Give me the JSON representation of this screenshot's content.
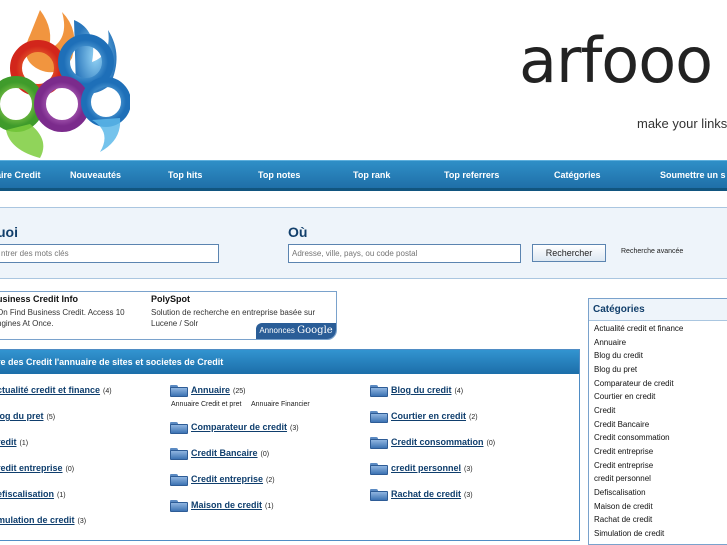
{
  "header": {
    "brand_word": "arfooo",
    "brand_tagline": "make your links"
  },
  "nav": {
    "items": [
      "aire Credit",
      "Nouveautés",
      "Top hits",
      "Top notes",
      "Top rank",
      "Top referrers",
      "Catégories",
      "Soumettre un s"
    ]
  },
  "search": {
    "what_heading": "uoi",
    "what_placeholder": "ntrer des mots clés",
    "where_heading": "Où",
    "where_placeholder": "Adresse, ville, pays, ou code postal",
    "button_label": "Rechercher",
    "advanced_link": "Recherche avancée"
  },
  "ads": {
    "items": [
      {
        "title": "usiness Credit Info",
        "text": "On Find Business Credit. Access 10 ngines At Once."
      },
      {
        "title": "PolySpot",
        "text": "Solution de recherche en entreprise basée sur Lucene / Solr"
      }
    ],
    "annonces_label": "Annonces",
    "google_label": "Google"
  },
  "directory": {
    "heading": "re des Credit l'annuaire de sites et societes de Credit",
    "columns": [
      [
        {
          "label": "ctualité credit et finance",
          "count": "(4)"
        },
        {
          "label": "log du pret",
          "count": "(5)"
        },
        {
          "label": "redit",
          "count": "(1)"
        },
        {
          "label": "redit entreprise",
          "count": "(0)"
        },
        {
          "label": "efiscalisation",
          "count": "(1)"
        },
        {
          "label": "mulation de credit",
          "count": "(3)"
        }
      ],
      [
        {
          "label": "Annuaire",
          "count": "(25)"
        },
        {
          "label": "Comparateur de credit",
          "count": "(3)"
        },
        {
          "label": "Credit Bancaire",
          "count": "(0)"
        },
        {
          "label": "Credit entreprise",
          "count": "(2)"
        },
        {
          "label": "Maison de credit",
          "count": "(1)"
        }
      ],
      [
        {
          "label": "Blog du credit",
          "count": "(4)"
        },
        {
          "label": "Courtier en credit",
          "count": "(2)"
        },
        {
          "label": "Credit consommation",
          "count": "(0)"
        },
        {
          "label": "credit personnel",
          "count": "(3)"
        },
        {
          "label": "Rachat de credit",
          "count": "(3)"
        }
      ]
    ],
    "annuaire_sublinks": [
      "Annuaire Credit et pret",
      "Annuaire Financier"
    ]
  },
  "categories": {
    "heading": "Catégories",
    "items": [
      "Actualité credit et finance",
      "Annuaire",
      "Blog du credit",
      "Blog du pret",
      "Comparateur de credit",
      "Courtier en credit",
      "Credit",
      "Credit Bancaire",
      "Credit consommation",
      "Credit entreprise",
      "Credit entreprise",
      "credit personnel",
      "Defiscalisation",
      "Maison de credit",
      "Rachat de credit",
      "Simulation de credit"
    ]
  }
}
